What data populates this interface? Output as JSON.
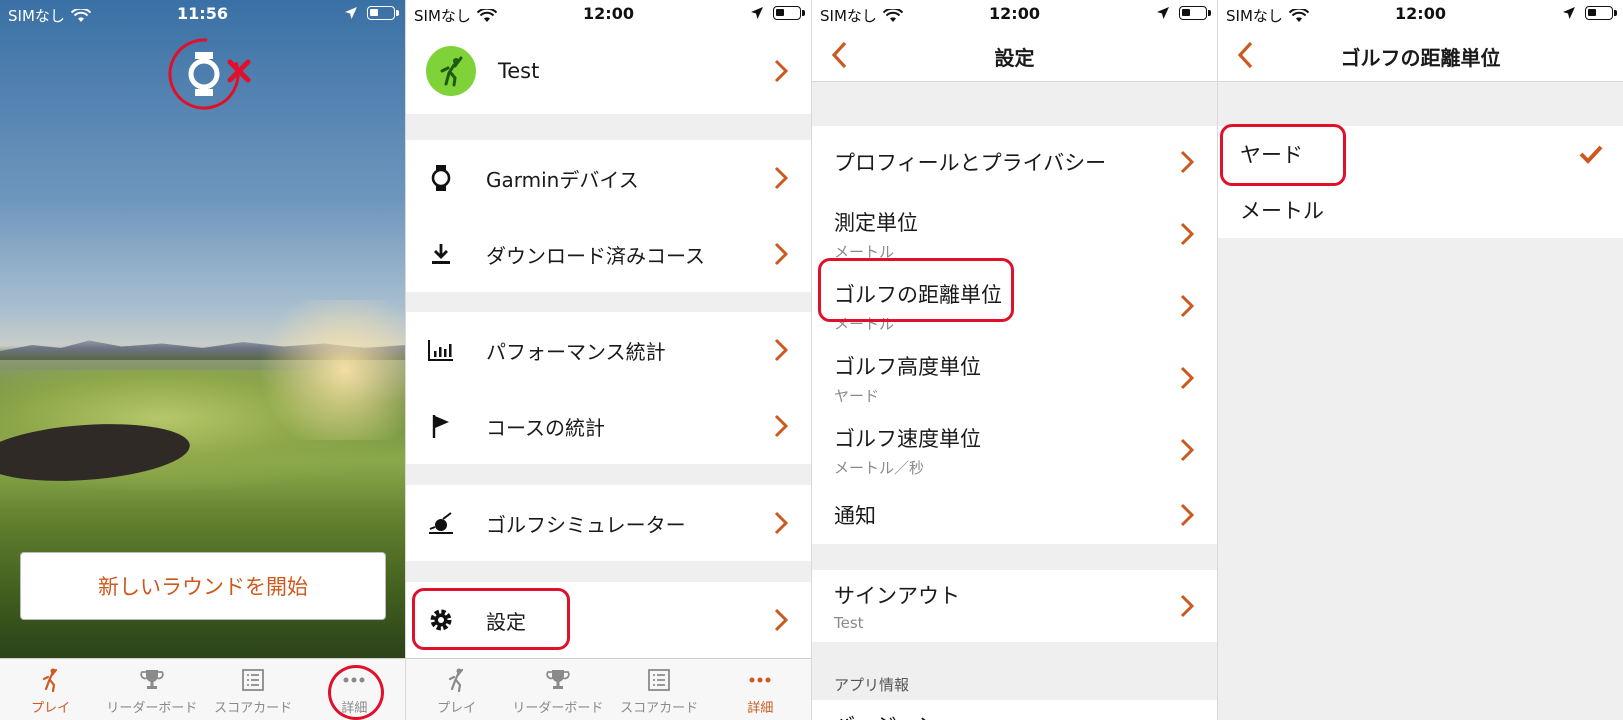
{
  "colors": {
    "accent": "#cc5a1f",
    "highlight": "#e0102a",
    "avatar": "#7fd238"
  },
  "screens": [
    {
      "status": {
        "carrier": "SIMなし",
        "time": "11:56"
      },
      "round_button": "新しいラウンドを開始",
      "tabs": [
        {
          "label": "プレイ",
          "icon": "golfer-icon",
          "active": true
        },
        {
          "label": "リーダーボード",
          "icon": "trophy-icon",
          "active": false
        },
        {
          "label": "スコアカード",
          "icon": "scorecard-icon",
          "active": false
        },
        {
          "label": "詳細",
          "icon": "more-dots-icon",
          "active": false
        }
      ]
    },
    {
      "status": {
        "carrier": "SIMなし",
        "time": "12:00"
      },
      "profile_name": "Test",
      "menu": [
        {
          "label": "Garminデバイス",
          "icon": "watch-icon"
        },
        {
          "label": "ダウンロード済みコース",
          "icon": "download-icon"
        },
        {
          "label": "パフォーマンス統計",
          "icon": "stats-icon"
        },
        {
          "label": "コースの統計",
          "icon": "flag-icon"
        },
        {
          "label": "ゴルフシミュレーター",
          "icon": "simulator-icon"
        },
        {
          "label": "設定",
          "icon": "gear-icon"
        }
      ],
      "tabs": [
        {
          "label": "プレイ"
        },
        {
          "label": "リーダーボード"
        },
        {
          "label": "スコアカード"
        },
        {
          "label": "詳細"
        }
      ]
    },
    {
      "status": {
        "carrier": "SIMなし",
        "time": "12:00"
      },
      "title": "設定",
      "items": [
        {
          "label": "プロフィールとプライバシー",
          "value": ""
        },
        {
          "label": "測定単位",
          "value": "メートル"
        },
        {
          "label": "ゴルフの距離単位",
          "value": "メートル"
        },
        {
          "label": "ゴルフ高度単位",
          "value": "ヤード"
        },
        {
          "label": "ゴルフ速度単位",
          "value": "メートル／秒"
        },
        {
          "label": "通知",
          "value": ""
        }
      ],
      "signout": {
        "label": "サインアウト",
        "value": "Test"
      },
      "app_info_header": "アプリ情報",
      "version_label": "バージョン"
    },
    {
      "status": {
        "carrier": "SIMなし",
        "time": "12:00"
      },
      "title": "ゴルフの距離単位",
      "options": [
        {
          "label": "ヤード",
          "selected": true
        },
        {
          "label": "メートル",
          "selected": false
        }
      ]
    }
  ]
}
